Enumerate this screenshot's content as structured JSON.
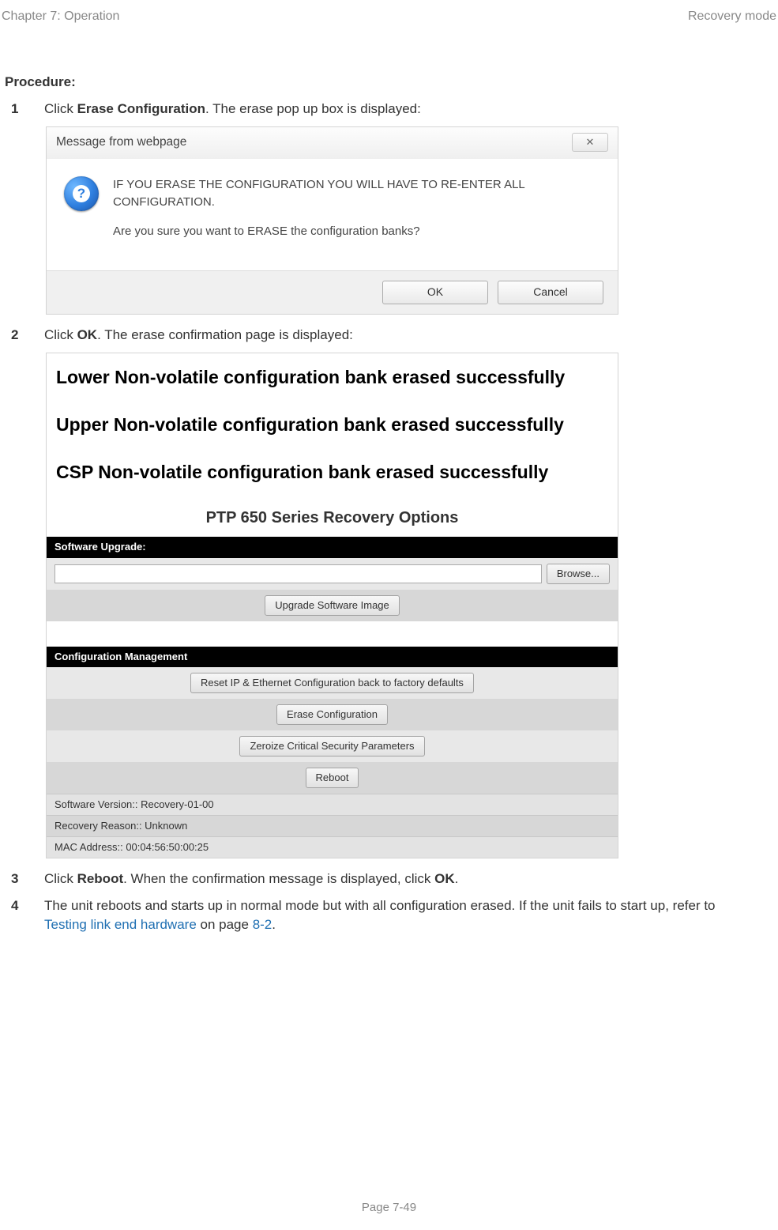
{
  "header": {
    "left": "Chapter 7:  Operation",
    "right": "Recovery mode"
  },
  "procedure_label": "Procedure:",
  "steps": {
    "s1": {
      "num": "1",
      "click": "Click ",
      "bold": "Erase Configuration",
      "rest": ". The erase pop up box is displayed:"
    },
    "s2": {
      "num": "2",
      "click": "Click ",
      "bold": "OK",
      "rest": ". The erase confirmation page is displayed:"
    },
    "s3": {
      "num": "3",
      "click": "Click ",
      "bold": "Reboot",
      "rest": ". When the confirmation message is displayed, click ",
      "bold2": "OK",
      "rest2": "."
    },
    "s4": {
      "num": "4",
      "text_a": "The unit reboots and starts up in normal mode but with all configuration erased. If the unit fails to start up, refer to ",
      "link": "Testing link end hardware",
      "text_b": " on page ",
      "pageref": "8-2",
      "text_c": "."
    }
  },
  "dialog1": {
    "title": "Message from webpage",
    "line1": "IF YOU ERASE THE CONFIGURATION YOU WILL HAVE TO RE-ENTER ALL CONFIGURATION.",
    "line2": "Are you sure you want to ERASE the configuration banks?",
    "ok": "OK",
    "cancel": "Cancel",
    "close_glyph": "✕"
  },
  "recovery": {
    "msg1": "Lower Non-volatile configuration bank erased successfully",
    "msg2": "Upper Non-volatile configuration bank erased successfully",
    "msg3": "CSP Non-volatile configuration bank erased successfully",
    "title": "PTP 650 Series Recovery Options",
    "sw_upgrade_head": "Software Upgrade:",
    "browse_btn": "Browse...",
    "upgrade_btn": "Upgrade Software Image",
    "cfg_head": "Configuration Management",
    "reset_btn": "Reset IP & Ethernet Configuration back to factory defaults",
    "erase_btn": "Erase Configuration",
    "zeroize_btn": "Zeroize Critical Security Parameters",
    "reboot_btn": "Reboot",
    "sw_ver_label": "Software Version::  ",
    "sw_ver_value": "Recovery-01-00",
    "reason_label": "Recovery Reason::  ",
    "reason_value": "Unknown",
    "mac_label": "MAC Address::  ",
    "mac_value": "00:04:56:50:00:25"
  },
  "footer": {
    "page_label": "Page ",
    "page_num": "7-49"
  }
}
